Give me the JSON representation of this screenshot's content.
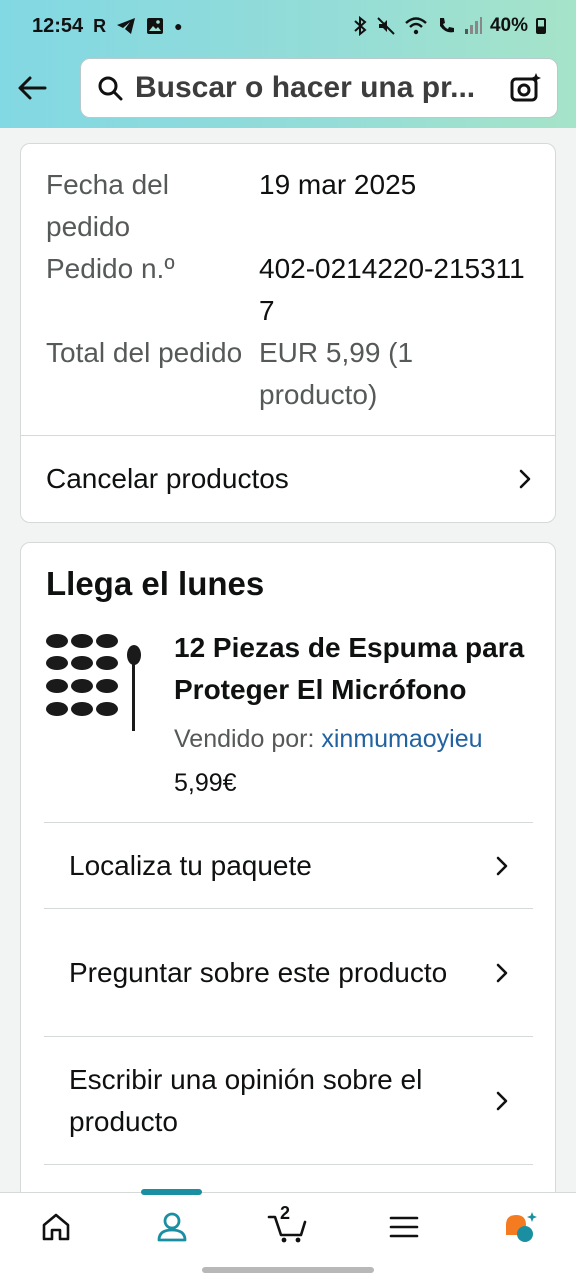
{
  "status_bar": {
    "time": "12:54",
    "left_glyphs": [
      "R"
    ],
    "battery": "40%"
  },
  "search": {
    "placeholder": "Buscar o hacer una pr..."
  },
  "order_info": {
    "rows": [
      {
        "label": "Fecha del pedido",
        "value": "19 mar 2025"
      },
      {
        "label": "Pedido n.º",
        "value": "402-0214220-2153117"
      },
      {
        "label": "Total del pedido",
        "value": "EUR 5,99 (1 producto)"
      }
    ],
    "cancel_label": "Cancelar productos"
  },
  "shipment": {
    "arrival_title": "Llega el lunes",
    "product_title": "12 Piezas de Espuma para Proteger El Micrófono",
    "seller_prefix": "Vendido por:",
    "seller_name": "xinmumaoyieu",
    "price": "5,99€",
    "actions": [
      {
        "label": "Localiza tu paquete"
      },
      {
        "label": "Preguntar sobre este producto"
      },
      {
        "label": "Escribir una opinión sobre el producto"
      }
    ]
  },
  "bottom_nav": {
    "items": [
      {
        "icon": "home-icon"
      },
      {
        "icon": "account-icon",
        "active": true
      },
      {
        "icon": "cart-icon",
        "count": "2"
      },
      {
        "icon": "menu-icon"
      },
      {
        "icon": "rufus-icon"
      }
    ]
  },
  "colors": {
    "header_gradient": [
      "#82d8e3",
      "#a6e4c9"
    ],
    "link": "#2162a1",
    "active_tab": "#1b8fa2"
  }
}
